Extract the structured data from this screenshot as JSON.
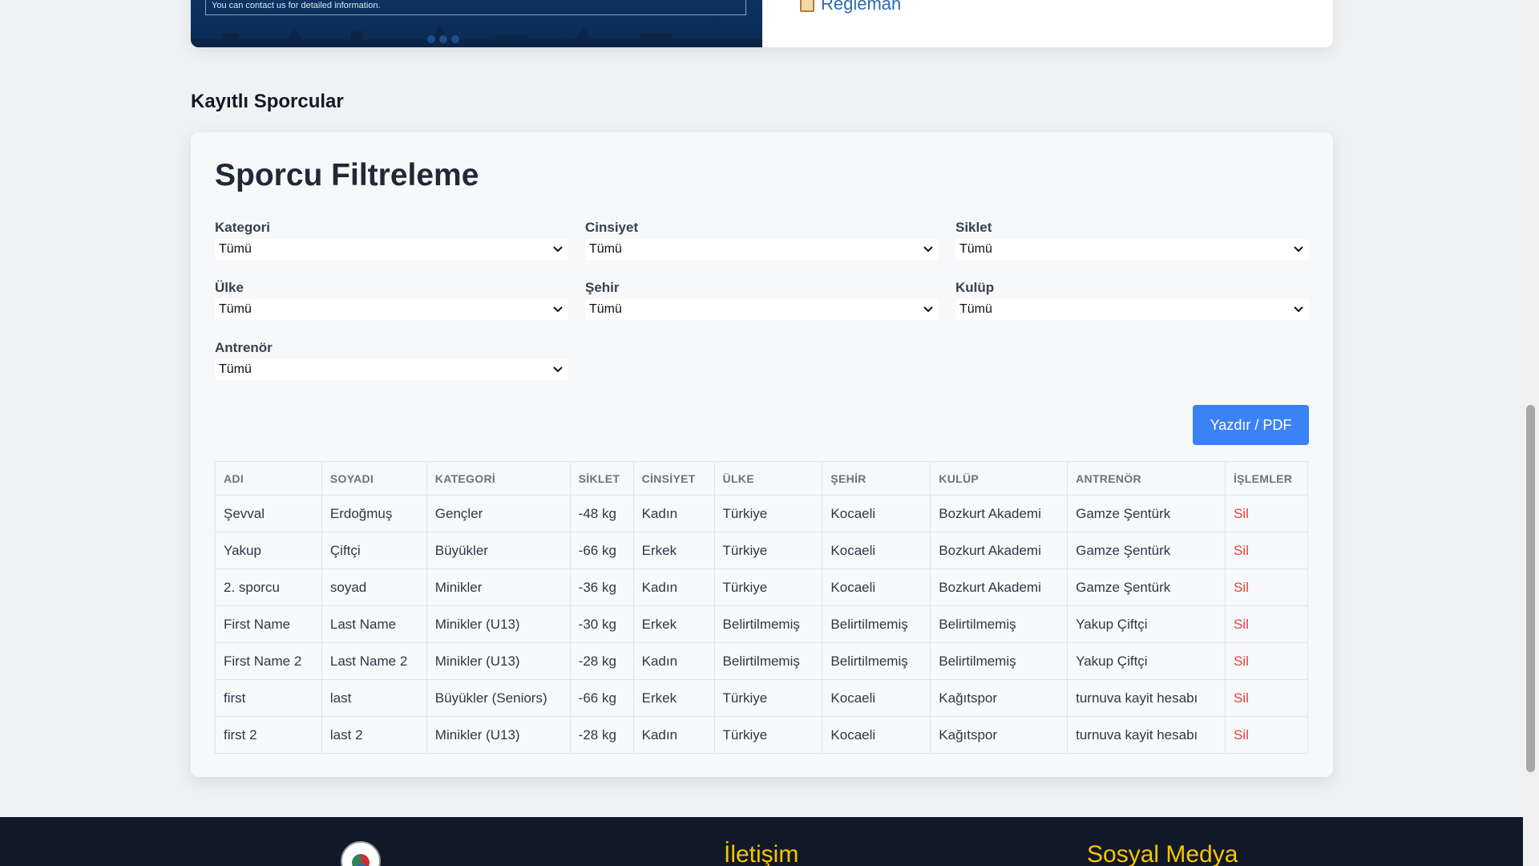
{
  "banner": {
    "text": "You can contact us for detailed information."
  },
  "top_link": {
    "label": "Reglеman"
  },
  "section": {
    "title": "Kayıtlı Sporcular"
  },
  "filter": {
    "title": "Sporcu Filtreleme",
    "fields": [
      {
        "label": "Kategori",
        "value": "Tümü"
      },
      {
        "label": "Cinsiyet",
        "value": "Tümü"
      },
      {
        "label": "Siklet",
        "value": "Tümü"
      },
      {
        "label": "Ülke",
        "value": "Tümü"
      },
      {
        "label": "Şehir",
        "value": "Tümü"
      },
      {
        "label": "Kulüp",
        "value": "Tümü"
      },
      {
        "label": "Antrenör",
        "value": "Tümü"
      }
    ],
    "print_label": "Yazdır / PDF"
  },
  "table": {
    "headers": [
      "ADI",
      "SOYADI",
      "KATEGORİ",
      "SİKLET",
      "CİNSİYET",
      "ÜLKE",
      "ŞEHİR",
      "KULÜP",
      "ANTRENÖR",
      "İŞLEMLER"
    ],
    "rows": [
      [
        "Şevval",
        "Erdoğmuş",
        "Gençler",
        "-48 kg",
        "Kadın",
        "Türkiye",
        "Kocaeli",
        "Bozkurt Akademi",
        "Gamze Şentürk",
        "Sil"
      ],
      [
        "Yakup",
        "Çiftçi",
        "Büyükler",
        "-66 kg",
        "Erkek",
        "Türkiye",
        "Kocaeli",
        "Bozkurt Akademi",
        "Gamze Şentürk",
        "Sil"
      ],
      [
        "2. sporcu",
        "soyad",
        "Minikler",
        "-36 kg",
        "Kadın",
        "Türkiye",
        "Kocaeli",
        "Bozkurt Akademi",
        "Gamze Şentürk",
        "Sil"
      ],
      [
        "First Name",
        "Last Name",
        "Minikler (U13)",
        "-30 kg",
        "Erkek",
        "Belirtilmemiş",
        "Belirtilmemiş",
        "Belirtilmemiş",
        "Yakup Çiftçi",
        "Sil"
      ],
      [
        "First Name 2",
        "Last Name 2",
        "Minikler (U13)",
        "-28 kg",
        "Kadın",
        "Belirtilmemiş",
        "Belirtilmemiş",
        "Belirtilmemiş",
        "Yakup Çiftçi",
        "Sil"
      ],
      [
        "first",
        "last",
        "Büyükler (Seniors)",
        "-66 kg",
        "Erkek",
        "Türkiye",
        "Kocaeli",
        "Kağıtspor",
        "turnuva kayit hesabı",
        "Sil"
      ],
      [
        "first 2",
        "last 2",
        "Minikler (U13)",
        "-28 kg",
        "Kadın",
        "Türkiye",
        "Kocaeli",
        "Kağıtspor",
        "turnuva kayit hesabı",
        "Sil"
      ]
    ]
  },
  "footer": {
    "contact_heading": "İletişim",
    "social_heading": "Sosyal Medya"
  },
  "colors": {
    "accent": "#3b82f6",
    "delete": "#e53e3e",
    "footer_bg": "#111827",
    "footer_heading": "#f6c500"
  }
}
